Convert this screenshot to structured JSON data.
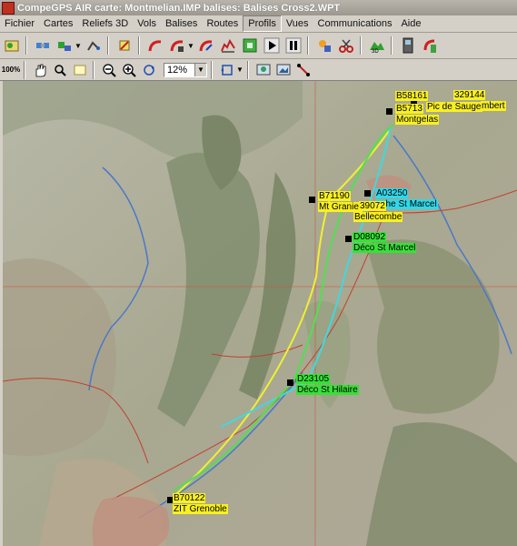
{
  "window": {
    "title": "CompeGPS AIR  carte: Montmelian.IMP balises:  Balises Cross2.WPT"
  },
  "menu": [
    "Fichier",
    "Cartes",
    "Reliefs 3D",
    "Vols",
    "Balises",
    "Routes",
    "Profils",
    "Vues",
    "Communications",
    "Aide"
  ],
  "menu_active": "Profils",
  "toolbar2": {
    "zoom_100_label": "100%",
    "zoom_value": "12%"
  },
  "waypoints": {
    "w1_code": "B58161",
    "w1_code2": "329144",
    "w1_name": "Pic de Sauge",
    "w1_name2": "mbert",
    "w2_code": "B5713",
    "w2_name": "Montgelas",
    "w3_code": "B71190",
    "w3_name": "Mt Granier",
    "w4_code": "A03250",
    "w4_name": "oche St Marcel",
    "w5_code": "39072",
    "w5_name": "Bellecombe",
    "w6_code": "D08092",
    "w6_name": "Déco St Marcel",
    "w7_code": "D23105",
    "w7_name": "Déco St Hilaire",
    "w8_code": "B70122",
    "w8_name": "ZIT Grenoble"
  },
  "colors": {
    "track_yellow": "#f0f030",
    "track_cyan": "#40d8e0",
    "track_green": "#50e050",
    "grid": "#d05040"
  }
}
